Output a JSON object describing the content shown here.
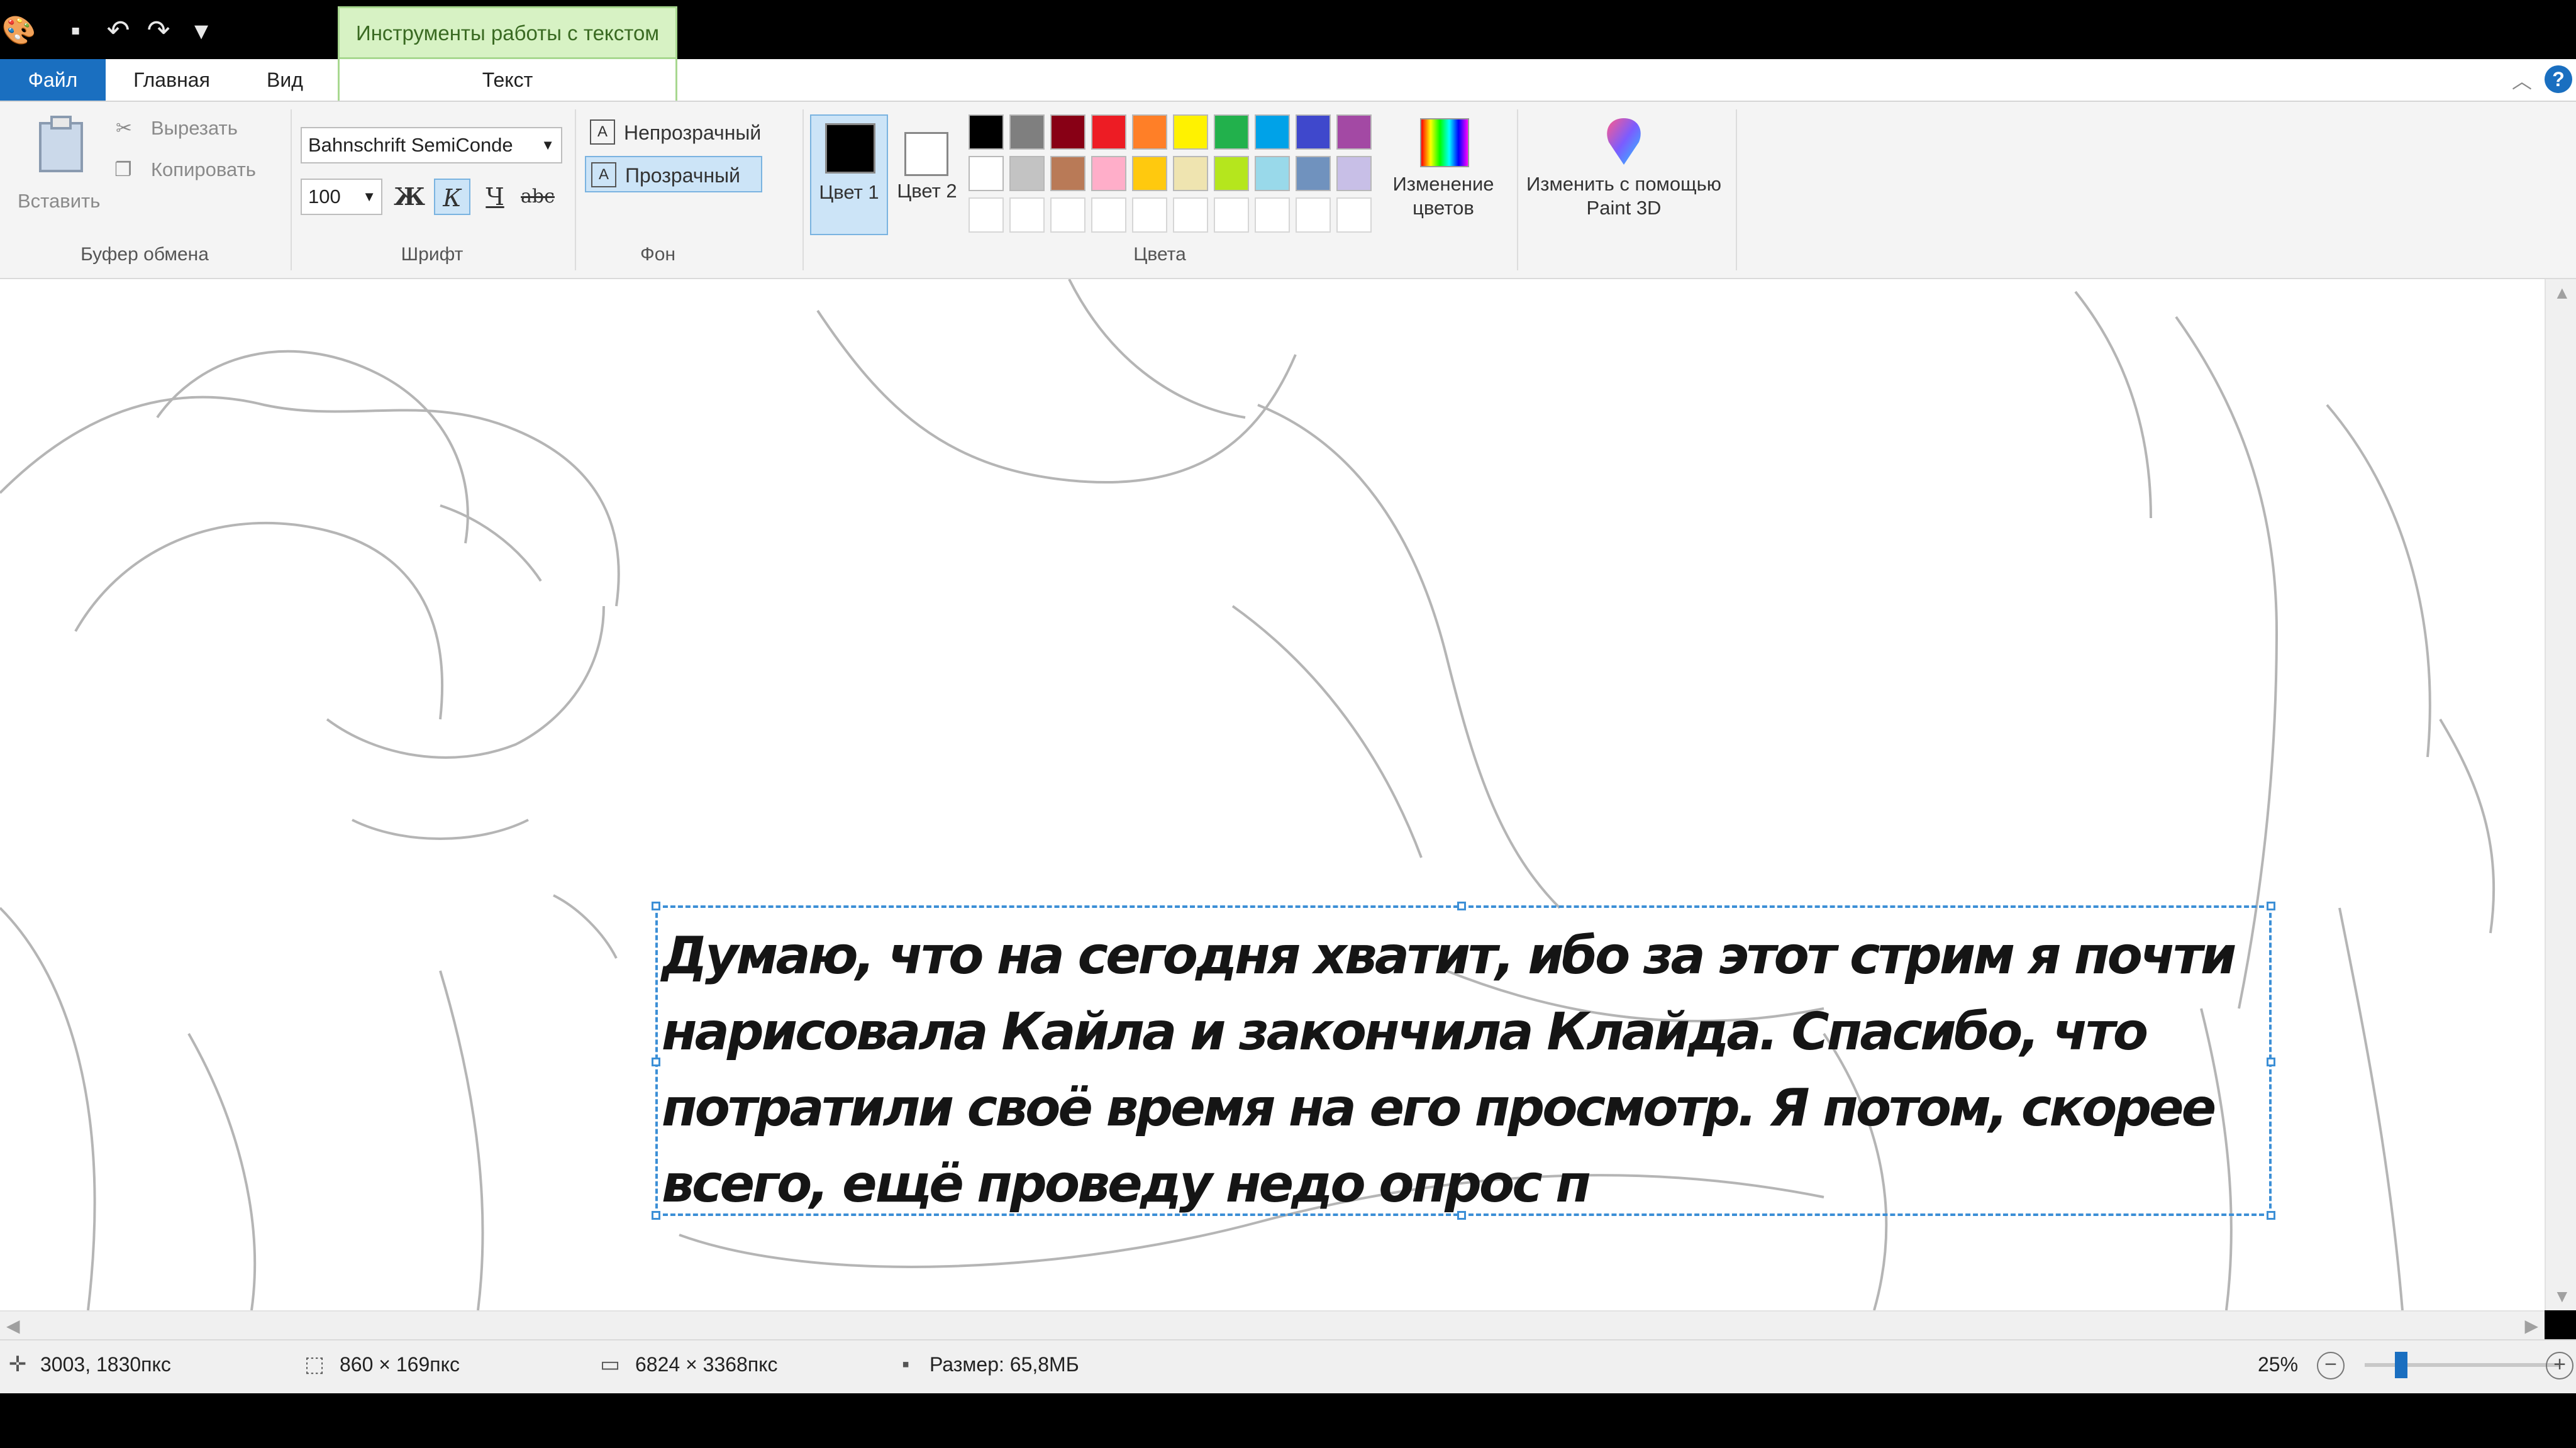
{
  "window": {
    "context_tab_label": "Инструменты работы с текстом"
  },
  "tabs": {
    "file": "Файл",
    "home": "Главная",
    "view": "Вид",
    "text": "Текст"
  },
  "clipboard": {
    "paste": "Вставить",
    "cut": "Вырезать",
    "copy": "Копировать",
    "group_label": "Буфер обмена"
  },
  "font": {
    "family": "Bahnschrift SemiConde",
    "size": "100",
    "bold": "Ж",
    "italic": "К",
    "underline": "Ч",
    "strikethrough": "abc",
    "group_label": "Шрифт"
  },
  "background": {
    "opaque": "Непрозрачный",
    "transparent": "Прозрачный",
    "group_label": "Фон"
  },
  "colors": {
    "color1_label": "Цвет 1",
    "color2_label": "Цвет 2",
    "color1": "#000000",
    "color2": "#ffffff",
    "palette_row1": [
      "#000000",
      "#7f7f7f",
      "#880015",
      "#ed1c24",
      "#ff7f27",
      "#fff200",
      "#22b14c",
      "#00a2e8",
      "#3f48cc",
      "#a349a4"
    ],
    "palette_row2": [
      "#ffffff",
      "#c3c3c3",
      "#b97a57",
      "#ffaec9",
      "#ffc90e",
      "#efe4b0",
      "#b5e61d",
      "#99d9ea",
      "#7092be",
      "#c8bfe7"
    ],
    "edit_colors": "Изменение цветов",
    "paint3d": "Изменить с помощью Paint 3D",
    "group_label": "Цвета"
  },
  "canvas": {
    "text": "Думаю, что на сегодня хватит, ибо за этот стрим я почти нарисовала Кайла и закончила Клайда. Спасибо, что потратили своё время на его просмотр. Я потом, скорее всего, ещё проведу недо опрос п"
  },
  "status": {
    "cursor_pos": "3003, 1830пкс",
    "selection_size": "860 × 169пкс",
    "image_size": "6824 × 3368пкс",
    "file_size": "Размер: 65,8МБ",
    "zoom": "25%",
    "zoom_value": 0.25
  }
}
